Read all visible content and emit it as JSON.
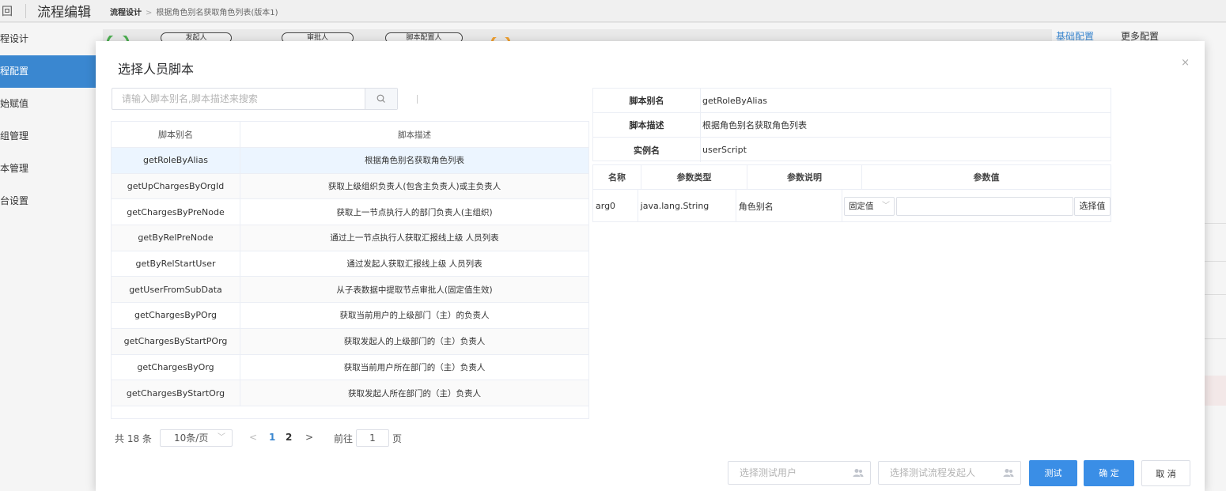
{
  "topbar": {
    "back": "回",
    "title": "流程编辑",
    "crumb_root": "流程设计",
    "crumb_sep": ">",
    "crumb_current": "根据角色别名获取角色列表(版本1)"
  },
  "sidebar": {
    "items": [
      {
        "label": "程设计"
      },
      {
        "label": "程配置"
      },
      {
        "label": "始赋值"
      },
      {
        "label": "组管理"
      },
      {
        "label": "本管理"
      },
      {
        "label": "台设置"
      }
    ]
  },
  "background": {
    "pills": [
      "发起人",
      "审批人",
      "脚本配置人"
    ],
    "tab_basic": "基础配置",
    "tab_more": "更多配置"
  },
  "dialog": {
    "title": "选择人员脚本",
    "close": "×",
    "search": {
      "placeholder": "请输入脚本别名,脚本描述来搜索",
      "value": ""
    },
    "list": {
      "col_alias": "脚本别名",
      "col_desc": "脚本描述",
      "rows": [
        {
          "alias": "getRoleByAlias",
          "desc": "根据角色别名获取角色列表"
        },
        {
          "alias": "getUpChargesByOrgId",
          "desc": "获取上级组织负责人(包含主负责人)或主负责人"
        },
        {
          "alias": "getChargesByPreNode",
          "desc": "获取上一节点执行人的部门负责人(主组织)"
        },
        {
          "alias": "getByRelPreNode",
          "desc": "通过上一节点执行人获取汇报线上级 人员列表"
        },
        {
          "alias": "getByRelStartUser",
          "desc": "通过发起人获取汇报线上级 人员列表"
        },
        {
          "alias": "getUserFromSubData",
          "desc": "从子表数据中提取节点审批人(固定值生效)"
        },
        {
          "alias": "getChargesByPOrg",
          "desc": "获取当前用户的上级部门（主）的负责人"
        },
        {
          "alias": "getChargesByStartPOrg",
          "desc": "获取发起人的上级部门的（主）负责人"
        },
        {
          "alias": "getChargesByOrg",
          "desc": "获取当前用户所在部门的（主）负责人"
        },
        {
          "alias": "getChargesByStartOrg",
          "desc": "获取发起人所在部门的（主）负责人"
        }
      ]
    },
    "pagination": {
      "total": "共 18 条",
      "page_size": "10条/页",
      "prev": "<",
      "pages": [
        "1",
        "2"
      ],
      "next": ">",
      "goto_label": "前往",
      "goto_value": "1",
      "page_suffix": "页"
    },
    "detail": {
      "alias_label": "脚本别名",
      "alias_value": "getRoleByAlias",
      "desc_label": "脚本描述",
      "desc_value": "根据角色别名获取角色列表",
      "instance_label": "实例名",
      "instance_value": "userScript"
    },
    "params": {
      "col_name": "名称",
      "col_type": "参数类型",
      "col_desc": "参数说明",
      "col_value": "参数值",
      "rows": [
        {
          "name": "arg0",
          "type": "java.lang.String",
          "desc": "角色别名",
          "mode": "固定值",
          "value": "",
          "pick": "选择值"
        }
      ]
    },
    "footer": {
      "test_user_placeholder": "选择测试用户",
      "test_starter_placeholder": "选择测试流程发起人",
      "test_button": "测试",
      "ok_button": "确 定",
      "cancel_button": "取 消"
    },
    "colors": {
      "primary": "#3a8ee6",
      "selected_row": "#ecf5ff"
    }
  }
}
